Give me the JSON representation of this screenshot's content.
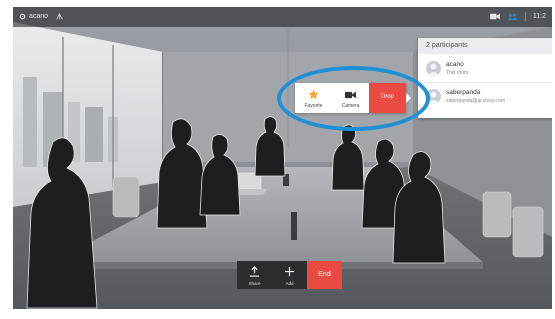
{
  "top_bar": {
    "device_name": "acano",
    "time": "11:2"
  },
  "participants_panel": {
    "header": "2 participants",
    "participants": [
      {
        "name": "acano",
        "detail": "This room"
      },
      {
        "name": "saberpanda",
        "detail": "saberpanda@ip.cisco.com"
      }
    ]
  },
  "participant_popup": {
    "favorite_label": "Favorite",
    "camera_label": "Camera",
    "drop_label": "Drop"
  },
  "call_controls": {
    "share_label": "Share",
    "add_label": "Add",
    "end_label": "End"
  },
  "colors": {
    "drop_end_red": "#e94b43",
    "highlight_ring_blue": "#1f8fd6",
    "favorite_star": "#f5a623"
  },
  "icons": [
    "gear-icon",
    "signal-icon",
    "camera-icon",
    "participants-icon",
    "person-icon",
    "star-icon",
    "share-icon",
    "plus-icon"
  ]
}
